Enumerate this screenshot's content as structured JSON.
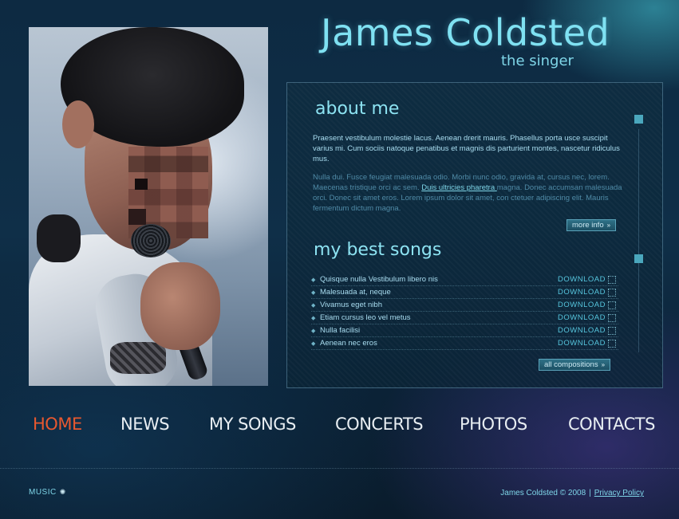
{
  "header": {
    "title": "James Coldsted",
    "subtitle": "the singer"
  },
  "about": {
    "heading": "about me",
    "para1": "Praesent vestibulum molestie lacus. Aenean drerit mauris. Phasellus porta usce suscipit varius mi. Cum sociis natoque penatibus et magnis dis parturient montes, nascetur ridiculus mus.",
    "para2_before": "Nulla dui. Fusce feugiat malesuada odio. Morbi nunc odio, gravida at, cursus nec, lorem. Maecenas tristique orci ac sem. ",
    "para2_link": "Duis ultricies pharetra ",
    "para2_after": "magna. Donec accumsan malesuada orci. Donec sit amet eros. Lorem ipsum dolor sit amet, con ctetuer adipiscing elit. Mauris fermentum dictum magna.",
    "more_label": "more info"
  },
  "songs": {
    "heading": "my best songs",
    "download_label": "DOWNLOAD",
    "items": [
      {
        "name": "Quisque nulla Vestibulum libero nis"
      },
      {
        "name": "Malesuada at, neque"
      },
      {
        "name": "Vivamus eget nibh"
      },
      {
        "name": "Etiam cursus leo vel metus"
      },
      {
        "name": "Nulla facilisi"
      },
      {
        "name": "Aenean nec eros"
      }
    ],
    "all_label": "all compositions"
  },
  "nav": {
    "items": [
      {
        "label": "HOME",
        "active": true
      },
      {
        "label": "NEWS"
      },
      {
        "label": "MY SONGS"
      },
      {
        "label": "CONCERTS"
      },
      {
        "label": "PHOTOS"
      },
      {
        "label": "CONTACTS"
      }
    ]
  },
  "footer": {
    "music_label": "MUSIC",
    "copyright": "James Coldsted © 2008",
    "separator": "|",
    "privacy": "Privacy Policy"
  },
  "colors": {
    "accent": "#7fd6e8",
    "nav_active": "#e8582f",
    "nav_default": "#e8eef2",
    "background": "#0f2f48"
  },
  "icons": {
    "download": "download-icon",
    "arrow": "double-arrow-icon",
    "music": "sun-icon"
  }
}
